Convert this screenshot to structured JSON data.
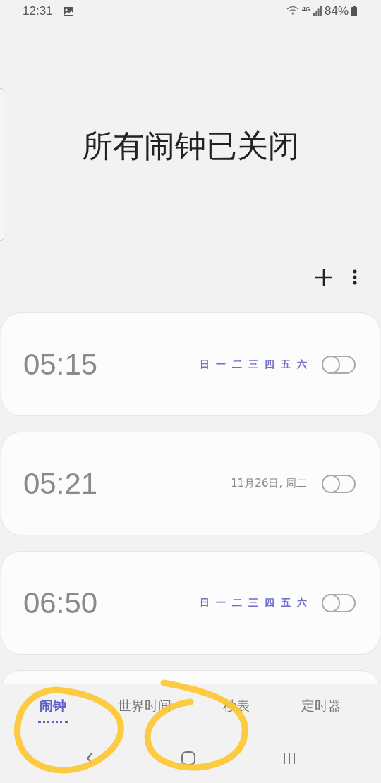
{
  "status_bar": {
    "time": "12:31",
    "battery": "84%",
    "network": "4G"
  },
  "header": {
    "title": "所有闹钟已关闭"
  },
  "alarms": [
    {
      "time": "05:15",
      "on": false,
      "kind": "days",
      "days": [
        {
          "label": "日",
          "selected": true
        },
        {
          "label": "一",
          "selected": true
        },
        {
          "label": "二",
          "selected": true
        },
        {
          "label": "三",
          "selected": true
        },
        {
          "label": "四",
          "selected": true
        },
        {
          "label": "五",
          "selected": true
        },
        {
          "label": "六",
          "selected": true
        }
      ]
    },
    {
      "time": "05:21",
      "on": false,
      "kind": "date",
      "date": "11月26日, 周二"
    },
    {
      "time": "06:50",
      "on": false,
      "kind": "days",
      "days": [
        {
          "label": "日",
          "selected": true
        },
        {
          "label": "一",
          "selected": true
        },
        {
          "label": "二",
          "selected": true
        },
        {
          "label": "三",
          "selected": true
        },
        {
          "label": "四",
          "selected": true
        },
        {
          "label": "五",
          "selected": true
        },
        {
          "label": "六",
          "selected": true
        }
      ]
    }
  ],
  "tabs": [
    {
      "label": "闹钟",
      "selected": true
    },
    {
      "label": "世界时间",
      "selected": false
    },
    {
      "label": "秒表",
      "selected": false
    },
    {
      "label": "定时器",
      "selected": false
    }
  ]
}
